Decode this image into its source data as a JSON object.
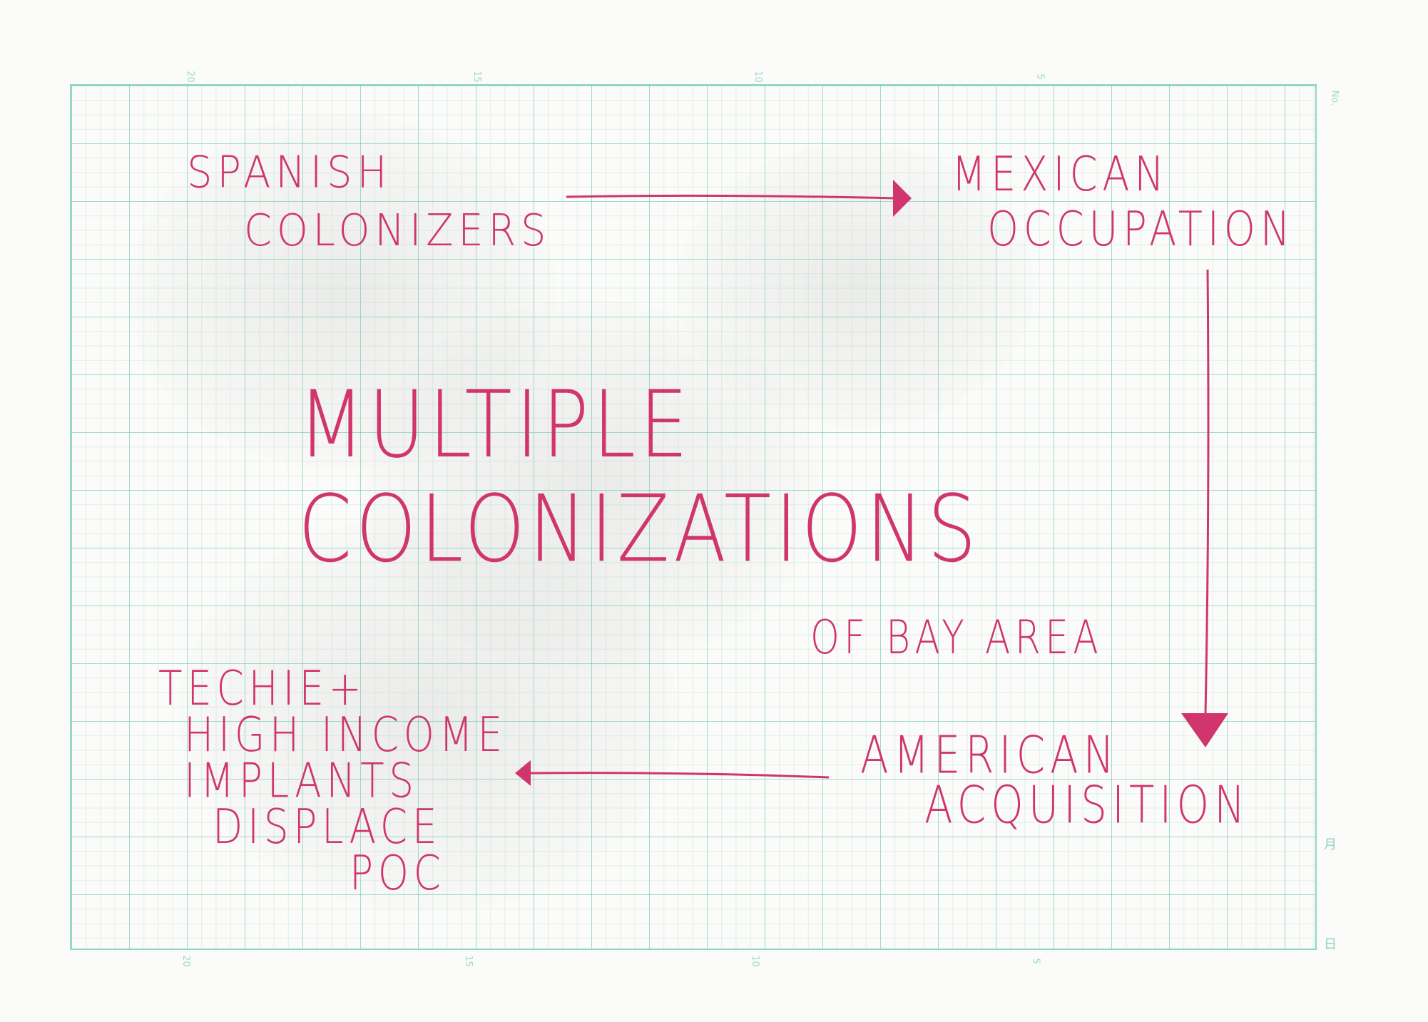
{
  "title": {
    "line1": "MULTIPLE",
    "line2": "COLONIZATIONS",
    "subtitle": "OF BAY AREA"
  },
  "nodes": {
    "spanish": {
      "line1": "SPANISH",
      "line2": "COLONIZERS"
    },
    "mexican": {
      "line1": "MEXICAN",
      "line2": "OCCUPATION"
    },
    "american": {
      "line1": "AMERICAN",
      "line2": "ACQUISITION"
    },
    "techie": {
      "line1": "TECHIE+",
      "line2": "HIGH INCOME",
      "line3": "IMPLANTS",
      "line4": "DISPLACE",
      "line5": "POC"
    }
  },
  "arrows": [
    {
      "from": "spanish",
      "to": "mexican"
    },
    {
      "from": "mexican",
      "to": "american"
    },
    {
      "from": "american",
      "to": "techie"
    }
  ],
  "grid_labels": {
    "top": [
      "20",
      "15",
      "10",
      "5",
      "No."
    ],
    "bottom": [
      "20",
      "15",
      "10",
      "5"
    ],
    "right": [
      "月",
      "日"
    ]
  },
  "colors": {
    "ink": "#d0356d",
    "grid": "#8fd6c4",
    "paper": "#fbfbf9"
  }
}
